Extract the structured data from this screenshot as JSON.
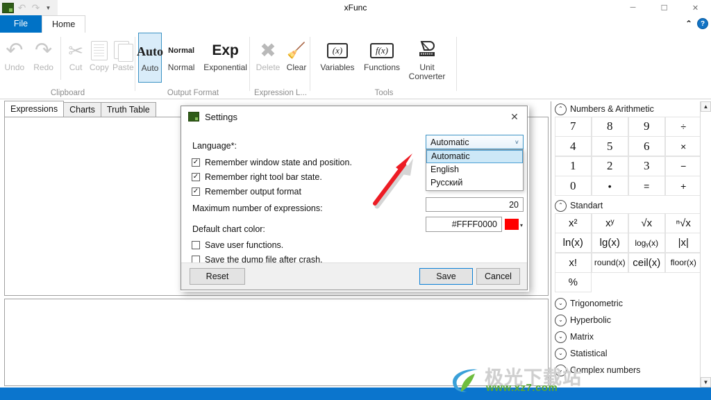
{
  "window": {
    "title": "xFunc",
    "app_icon": "xfunc-app-icon",
    "quick_access": [
      {
        "name": "undo-icon",
        "glyph": "↶"
      },
      {
        "name": "redo-icon",
        "glyph": "↷"
      },
      {
        "name": "qat-customize-icon",
        "glyph": "▼"
      }
    ],
    "controls": [
      {
        "name": "minimize-button",
        "glyph": "─"
      },
      {
        "name": "maximize-button",
        "glyph": "☐"
      },
      {
        "name": "close-button",
        "glyph": "✕"
      }
    ]
  },
  "ribbon": {
    "tabs": [
      {
        "label": "File",
        "active": false
      },
      {
        "label": "Home",
        "active": true
      }
    ],
    "collapse_glyph": "⌃",
    "help_glyph": "?",
    "groups": [
      {
        "title": "Clipboard",
        "items": [
          {
            "label": "Undo",
            "icon": "undo-icon",
            "disabled": true
          },
          {
            "label": "Redo",
            "icon": "redo-icon",
            "disabled": true
          },
          {
            "label": "Cut",
            "icon": "scissors-icon",
            "disabled": true
          },
          {
            "label": "Copy",
            "icon": "copy-icon",
            "disabled": true
          },
          {
            "label": "Paste",
            "icon": "paste-icon",
            "disabled": true
          }
        ]
      },
      {
        "title": "Output Format",
        "items": [
          {
            "label": "Auto",
            "big": "Auto",
            "icon": "auto-format-icon",
            "selected": true
          },
          {
            "label": "Normal",
            "big": "Normal",
            "icon": "normal-format-icon",
            "selected": false
          },
          {
            "label": "Exponential",
            "big": "Exp",
            "icon": "exponential-format-icon",
            "selected": false
          }
        ]
      },
      {
        "title": "Expression L...",
        "items": [
          {
            "label": "Delete",
            "icon": "delete-icon",
            "disabled": true
          },
          {
            "label": "Clear",
            "icon": "broom-icon",
            "disabled": false
          }
        ]
      },
      {
        "title": "Tools",
        "items": [
          {
            "label": "Variables",
            "icon": "variables-icon",
            "big": "(x)"
          },
          {
            "label": "Functions",
            "icon": "functions-icon",
            "big": "f(x)"
          },
          {
            "label": "Unit Converter",
            "icon": "unit-converter-icon",
            "big": "◷"
          }
        ]
      }
    ]
  },
  "work_tabs": [
    {
      "label": "Expressions",
      "active": true
    },
    {
      "label": "Charts",
      "active": false
    },
    {
      "label": "Truth Table",
      "active": false
    }
  ],
  "right_panel": {
    "sections": [
      {
        "title": "Numbers & Arithmetic",
        "expanded": true,
        "collapse_glyph": "⌃",
        "keys": [
          {
            "label": "7",
            "style": ""
          },
          {
            "label": "8",
            "style": ""
          },
          {
            "label": "9",
            "style": ""
          },
          {
            "label": "÷",
            "style": "sym"
          },
          {
            "label": "4",
            "style": ""
          },
          {
            "label": "5",
            "style": ""
          },
          {
            "label": "6",
            "style": ""
          },
          {
            "label": "×",
            "style": "sym"
          },
          {
            "label": "1",
            "style": ""
          },
          {
            "label": "2",
            "style": ""
          },
          {
            "label": "3",
            "style": ""
          },
          {
            "label": "−",
            "style": "sym"
          },
          {
            "label": "0",
            "style": ""
          },
          {
            "label": "•",
            "style": "sym"
          },
          {
            "label": "=",
            "style": "sym"
          },
          {
            "label": "+",
            "style": "sym"
          }
        ]
      },
      {
        "title": "Standart",
        "expanded": true,
        "collapse_glyph": "⌃",
        "keys": [
          {
            "label": "x²",
            "style": "med"
          },
          {
            "label": "xʸ",
            "style": "med"
          },
          {
            "label": "√x",
            "style": "med"
          },
          {
            "label": "ⁿ√x",
            "style": "med"
          },
          {
            "label": "ln(x)",
            "style": "med"
          },
          {
            "label": "lg(x)",
            "style": "med"
          },
          {
            "label": "logᵧ(x)",
            "style": "small"
          },
          {
            "label": "|x|",
            "style": "med"
          },
          {
            "label": "x!",
            "style": "med"
          },
          {
            "label": "round(x)",
            "style": "small"
          },
          {
            "label": "ceil(x)",
            "style": "med"
          },
          {
            "label": "floor(x)",
            "style": "small"
          },
          {
            "label": "%",
            "style": "med"
          }
        ]
      }
    ],
    "collapsed_sections": [
      {
        "title": "Trigonometric",
        "expand_glyph": "⌄"
      },
      {
        "title": "Hyperbolic",
        "expand_glyph": "⌄"
      },
      {
        "title": "Matrix",
        "expand_glyph": "⌄"
      },
      {
        "title": "Statistical",
        "expand_glyph": "⌄"
      },
      {
        "title": "Complex numbers",
        "expand_glyph": "⌄"
      }
    ],
    "scrollbar": {
      "up_glyph": "▲",
      "down_glyph": "▼"
    }
  },
  "dialog": {
    "title": "Settings",
    "icon": "settings-app-icon",
    "close_glyph": "✕",
    "language_label": "Language*:",
    "language_value": "Automatic",
    "language_caret": "˅",
    "language_options": [
      {
        "label": "Automatic",
        "selected": true
      },
      {
        "label": "English",
        "selected": false
      },
      {
        "label": "Русский",
        "selected": false
      }
    ],
    "checkboxes": [
      {
        "label": "Remember window state and position.",
        "checked": true,
        "glyph": "✓"
      },
      {
        "label": "Remember right tool bar state.",
        "checked": true,
        "glyph": "✓"
      },
      {
        "label": "Remember output format",
        "checked": true,
        "glyph": "✓"
      },
      {
        "label": "Save user functions.",
        "checked": false,
        "glyph": ""
      },
      {
        "label": "Save the dump file after crash.",
        "checked": false,
        "glyph": ""
      }
    ],
    "max_expressions_label": "Maximum number of expressions:",
    "max_expressions_value": "20",
    "chart_color_label": "Default chart color:",
    "chart_color_value": "#FFFF0000",
    "chart_color_swatch": "#FF0000",
    "swatch_caret": "▾",
    "buttons": [
      {
        "name": "reset-button",
        "label": "Reset"
      },
      {
        "name": "save-button",
        "label": "Save"
      },
      {
        "name": "cancel-button",
        "label": "Cancel"
      }
    ]
  },
  "annotation": {
    "arrow_color": "#ED1C24",
    "description": "red-arrow-pointing-to-language-dropdown"
  },
  "watermark": {
    "text_cn": "极光下载站",
    "text_url": "www.xz7.com"
  },
  "colors": {
    "accent_blue": "#0072c6",
    "status_bar": "#0b75cd",
    "selection": "#cde8f7"
  }
}
